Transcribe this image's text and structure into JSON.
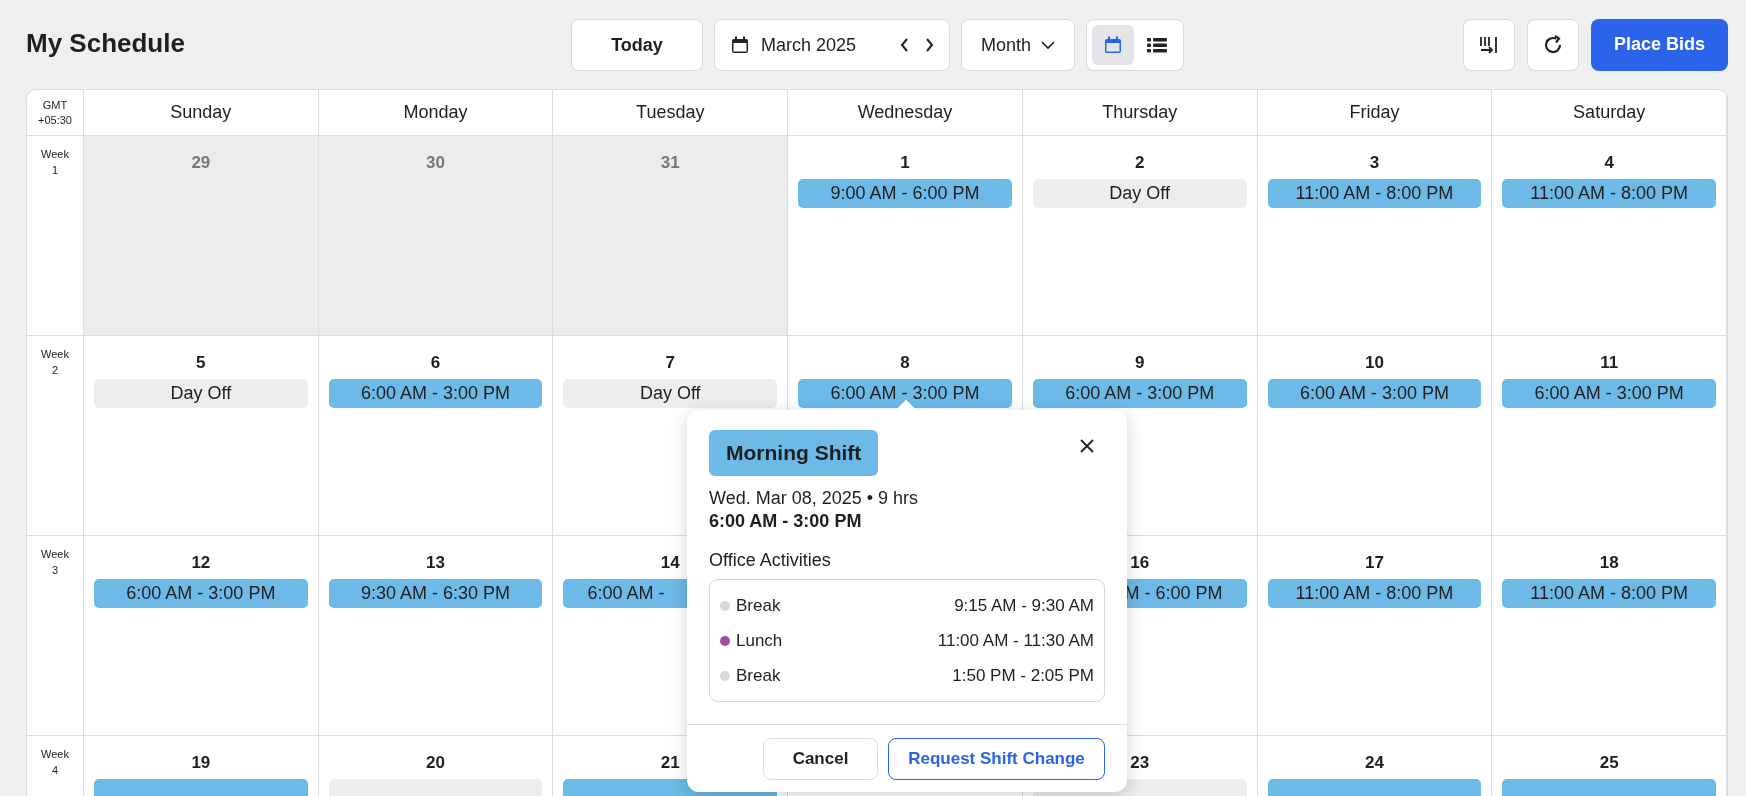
{
  "title": "My Schedule",
  "toolbar": {
    "today": "Today",
    "period": "March 2025",
    "view_select": "Month",
    "views": [
      {
        "kind": "calendar",
        "selected": true
      },
      {
        "kind": "list",
        "selected": false
      }
    ],
    "place_bids": "Place Bids"
  },
  "calendar": {
    "timezone": [
      "GMT",
      "+05:30"
    ],
    "days": [
      "Sunday",
      "Monday",
      "Tuesday",
      "Wednesday",
      "Thursday",
      "Friday",
      "Saturday"
    ],
    "weeks": [
      {
        "label": "Week",
        "number": "1",
        "cells": [
          {
            "date": "29",
            "outside": true
          },
          {
            "date": "30",
            "outside": true
          },
          {
            "date": "31",
            "outside": true
          },
          {
            "date": "1",
            "outside": false,
            "shift": {
              "kind": "shift",
              "text": "9:00 AM - 6:00 PM"
            }
          },
          {
            "date": "2",
            "outside": false,
            "shift": {
              "kind": "off",
              "text": "Day Off"
            }
          },
          {
            "date": "3",
            "outside": false,
            "shift": {
              "kind": "shift",
              "text": "11:00 AM - 8:00 PM"
            }
          },
          {
            "date": "4",
            "outside": false,
            "shift": {
              "kind": "shift",
              "text": "11:00 AM - 8:00 PM"
            }
          }
        ]
      },
      {
        "label": "Week",
        "number": "2",
        "cells": [
          {
            "date": "5",
            "outside": false,
            "shift": {
              "kind": "off",
              "text": "Day Off"
            }
          },
          {
            "date": "6",
            "outside": false,
            "shift": {
              "kind": "shift",
              "text": "6:00 AM - 3:00 PM"
            }
          },
          {
            "date": "7",
            "outside": false,
            "shift": {
              "kind": "off",
              "text": "Day Off"
            }
          },
          {
            "date": "8",
            "outside": false,
            "shift": {
              "kind": "shift",
              "text": "6:00 AM - 3:00 PM"
            }
          },
          {
            "date": "9",
            "outside": false,
            "shift": {
              "kind": "shift",
              "text": "6:00 AM - 3:00 PM"
            }
          },
          {
            "date": "10",
            "outside": false,
            "shift": {
              "kind": "shift",
              "text": "6:00 AM - 3:00 PM"
            }
          },
          {
            "date": "11",
            "outside": false,
            "shift": {
              "kind": "shift",
              "text": "6:00 AM - 3:00 PM"
            }
          }
        ]
      },
      {
        "label": "Week",
        "number": "3",
        "cells": [
          {
            "date": "12",
            "outside": false,
            "shift": {
              "kind": "shift",
              "text": "6:00 AM - 3:00 PM"
            }
          },
          {
            "date": "13",
            "outside": false,
            "shift": {
              "kind": "shift",
              "text": "9:30 AM - 6:30 PM"
            }
          },
          {
            "date": "14",
            "outside": false,
            "shift": {
              "kind": "shift",
              "text": "6:00 AM -",
              "cut_end": true
            }
          },
          null,
          {
            "date": "16",
            "outside": false,
            "shift": {
              "kind": "shift",
              "text": "M - 6:00 PM",
              "cut_start": true
            }
          },
          {
            "date": "17",
            "outside": false,
            "shift": {
              "kind": "shift",
              "text": "11:00 AM - 8:00 PM"
            }
          },
          {
            "date": "18",
            "outside": false,
            "shift": {
              "kind": "shift",
              "text": "11:00 AM - 8:00 PM"
            }
          }
        ]
      },
      {
        "label": "Week",
        "number": "4",
        "cells": [
          {
            "date": "19",
            "outside": false,
            "shift": {
              "kind": "shift"
            }
          },
          {
            "date": "20",
            "outside": false,
            "shift": {
              "kind": "off"
            }
          },
          {
            "date": "21",
            "outside": false,
            "shift": {
              "kind": "shift"
            }
          },
          null,
          {
            "date": "23",
            "outside": false,
            "shift": {
              "kind": "off"
            }
          },
          {
            "date": "24",
            "outside": false,
            "shift": {
              "kind": "shift"
            }
          },
          {
            "date": "25",
            "outside": false,
            "shift": {
              "kind": "shift"
            }
          }
        ]
      }
    ]
  },
  "popover": {
    "tag": "Morning Shift",
    "date_line": "Wed. Mar 08, 2025 • 9 hrs",
    "time": "6:00 AM - 3:00 PM",
    "section": "Office Activities",
    "activities": [
      {
        "name": "Break",
        "time": "9:15 AM - 9:30 AM",
        "color": "#d9d9d9"
      },
      {
        "name": "Lunch",
        "time": "11:00 AM - 11:30 AM",
        "color": "#9b4f9e"
      },
      {
        "name": "Break",
        "time": "1:50 PM - 2:05 PM",
        "color": "#d9d9d9"
      }
    ],
    "cancel": "Cancel",
    "request": "Request Shift Change"
  }
}
